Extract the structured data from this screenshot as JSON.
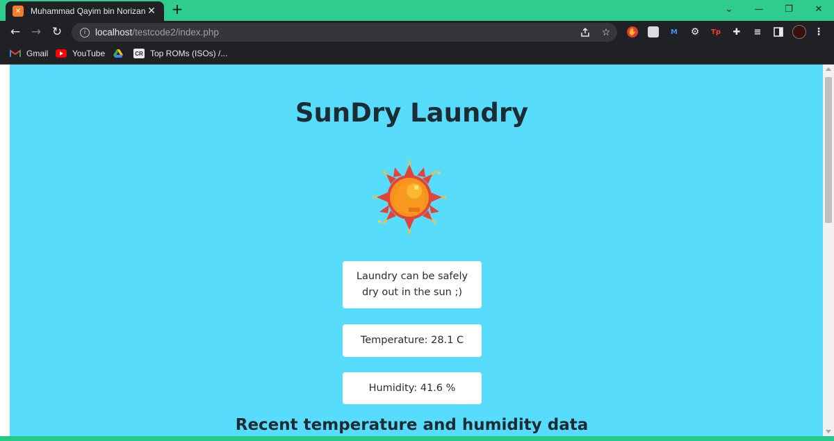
{
  "browser": {
    "tab": {
      "title": "Muhammad Qayim bin Norizan",
      "close": "✕"
    },
    "new_tab": "+",
    "window_controls": {
      "chevron": "⌄",
      "minimize": "—",
      "restore": "❐",
      "close": "✕"
    },
    "nav": {
      "back": "←",
      "forward": "→",
      "reload": "↻"
    },
    "url": {
      "host": "localhost",
      "path": "/testcode2/index.php"
    },
    "bookmarks": [
      {
        "label": "Gmail",
        "icon": "gmail-icon"
      },
      {
        "label": "YouTube",
        "icon": "youtube-icon"
      },
      {
        "label": "",
        "icon": "google-drive-icon"
      },
      {
        "label": "Top ROMs (ISOs) /...",
        "icon": "cdromance-icon"
      }
    ],
    "extension_text": {
      "tp": "Tp",
      "m": "M"
    }
  },
  "page": {
    "title": "SunDry Laundry",
    "status_message": "Laundry can be safely dry out in the sun ;)",
    "temperature": "Temperature: 28.1 C",
    "humidity": "Humidity: 41.6 %",
    "recent_heading": "Recent temperature and humidity data"
  },
  "colors": {
    "page_bg": "#58dcfc",
    "chrome_frame": "#2ecc8e",
    "toolbar": "#202124"
  }
}
